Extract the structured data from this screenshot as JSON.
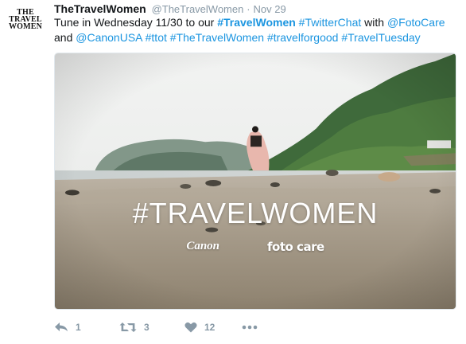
{
  "tweet": {
    "avatar_lines": [
      "THE",
      "TRAVEL",
      "WOMEN"
    ],
    "display_name": "TheTravelWomen",
    "handle": "@TheTravelWomen",
    "separator": "·",
    "date": "Nov 29",
    "text": {
      "t1": "Tune in Wednesday 11/30 to our ",
      "tag_travelwomen": "#TravelWomen",
      "t2": " ",
      "tag_twitterchat": "#TwitterChat",
      "t3": " with ",
      "mention_fotocare": "@FotoCare",
      "t4": "and ",
      "mention_canonusa": "@CanonUSA",
      "t5": " ",
      "tag_ttot": "#ttot",
      "t6": " ",
      "tag_thetravelwomen": "#TheTravelWomen",
      "t7": " ",
      "tag_travelforgood": "#travelforgood",
      "t8": " ",
      "tag_traveltuesday": "#TravelTuesday"
    },
    "media": {
      "hashtag": "#TRAVELWOMEN",
      "logo_left": "Canon",
      "logo_right": "foto care"
    },
    "actions": {
      "reply_icon": "reply-icon",
      "reply_count": "1",
      "retweet_icon": "retweet-icon",
      "retweet_count": "3",
      "like_icon": "heart-icon",
      "like_count": "12",
      "more_icon": "more-dots-icon"
    },
    "colors": {
      "link": "#1b95e0",
      "muted": "#8899a6",
      "text": "#14171a"
    }
  }
}
